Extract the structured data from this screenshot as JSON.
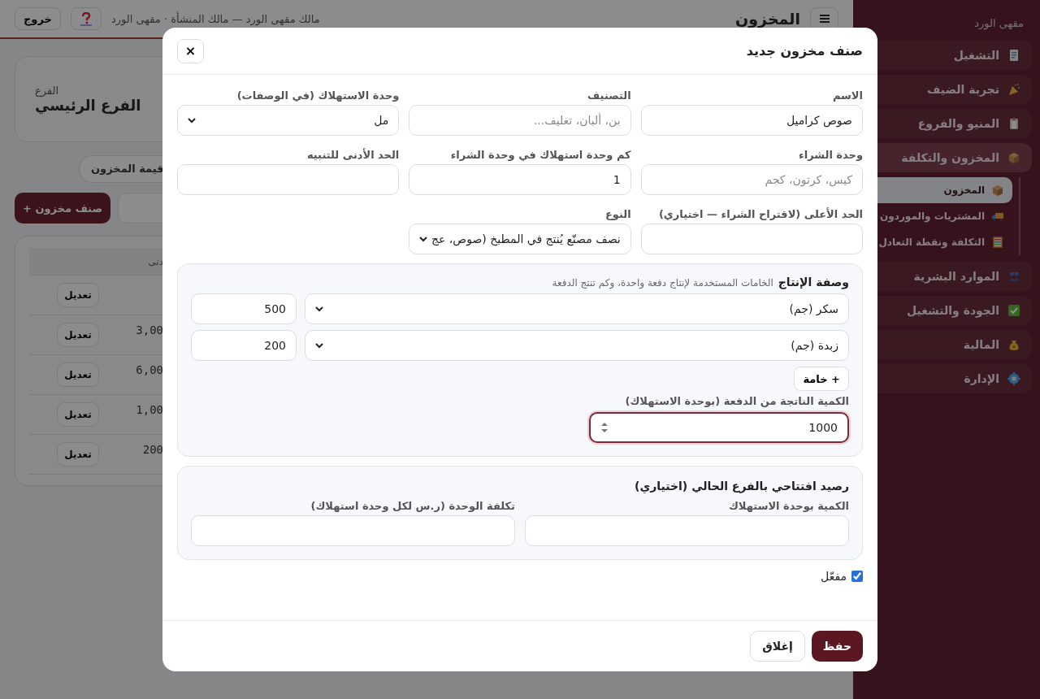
{
  "sidebar": {
    "brand": "مقهى الورد",
    "items": [
      {
        "label": "التشغيل",
        "selected": false
      },
      {
        "label": "تجربة الضيف",
        "selected": false
      },
      {
        "label": "المنيو والفروع",
        "selected": false
      },
      {
        "label": "المخزون والتكلفة",
        "selected": false,
        "expanded": true,
        "children": [
          {
            "label": "المخزون",
            "selected": true
          },
          {
            "label": "المشتريات والموردون",
            "selected": false
          },
          {
            "label": "التكلفة ونقطة التعادل",
            "selected": false
          }
        ]
      },
      {
        "label": "الموارد البشرية",
        "selected": false
      },
      {
        "label": "الجودة والتشغيل",
        "selected": false
      },
      {
        "label": "المالية",
        "selected": false
      },
      {
        "label": "الإدارة",
        "selected": false
      }
    ]
  },
  "topbar": {
    "title": "المخزون",
    "subtitle": "مالك مقهى الورد — مالك المنشأة · مقهى الورد",
    "logout": "خروج"
  },
  "branch": {
    "label": "الفرع",
    "name": "الفرع الرئيسي"
  },
  "summary_chip": "قيمة المخزون",
  "add_button": "+ صنف مخزون",
  "table": {
    "columns": [
      "دنى"
    ],
    "rows": [
      {
        "action": "تعديل"
      },
      {
        "column_1": "3,00",
        "action": "تعديل"
      },
      {
        "column_1": "6,00",
        "action": "تعديل"
      },
      {
        "column_1": "1,00",
        "action": "تعديل"
      },
      {
        "column_1": "200",
        "action": "تعديل"
      }
    ]
  },
  "dialog": {
    "title": "صنف مخزون جديد",
    "close": "×",
    "fields": [
      {
        "label": "الاسم",
        "kind": "text",
        "value": "صوص كراميل"
      },
      {
        "label": "التصنيف",
        "kind": "text",
        "placeholder": "بن، ألبان، تغليف..."
      },
      {
        "label": "وحدة الاستهلاك (في الوصفات)",
        "kind": "select",
        "value": "مل"
      },
      {
        "label": "وحدة الشراء",
        "kind": "text",
        "placeholder": "كيس، كرتون، كجم"
      },
      {
        "label": "كم وحدة استهلاك في وحدة الشراء",
        "kind": "text",
        "value": "1"
      },
      {
        "label": "الحد الأدنى للتنبيه",
        "kind": "text"
      },
      {
        "label": "الحد الأعلى (لاقتراح الشراء — اختياري)",
        "kind": "text"
      },
      {
        "label": "النوع",
        "kind": "select",
        "value": "نصف مصنّع يُنتج في المطبخ (صوص، عج"
      }
    ],
    "recipe": {
      "title": "وصفة الإنتاج",
      "hint": "الخامات المستخدمة لإنتاج دفعة واحدة، وكم تنتج الدفعة",
      "ingredients": [
        {
          "item": "سكر (جم)",
          "quantity": "500"
        },
        {
          "item": "زبدة (جم)",
          "quantity": "200"
        }
      ],
      "add_button": "+ خامة",
      "output_label": "الكمية الناتجة من الدفعة (بوحدة الاستهلاك)",
      "output_value": "1000",
      "output_focused": true
    },
    "opening": {
      "title": "رصيد افتتاحي بالفرع الحالي (اختياري)",
      "fields": [
        {
          "label": "الكمية بوحدة الاستهلاك"
        },
        {
          "label": "تكلفة الوحدة (ر.س لكل وحدة استهلاك)"
        }
      ]
    },
    "active": {
      "label": "مفعّل",
      "checked": true
    },
    "buttons": [
      {
        "label": "حفظ",
        "kind": "primary"
      },
      {
        "label": "إغلاق",
        "kind": "secondary"
      }
    ]
  }
}
